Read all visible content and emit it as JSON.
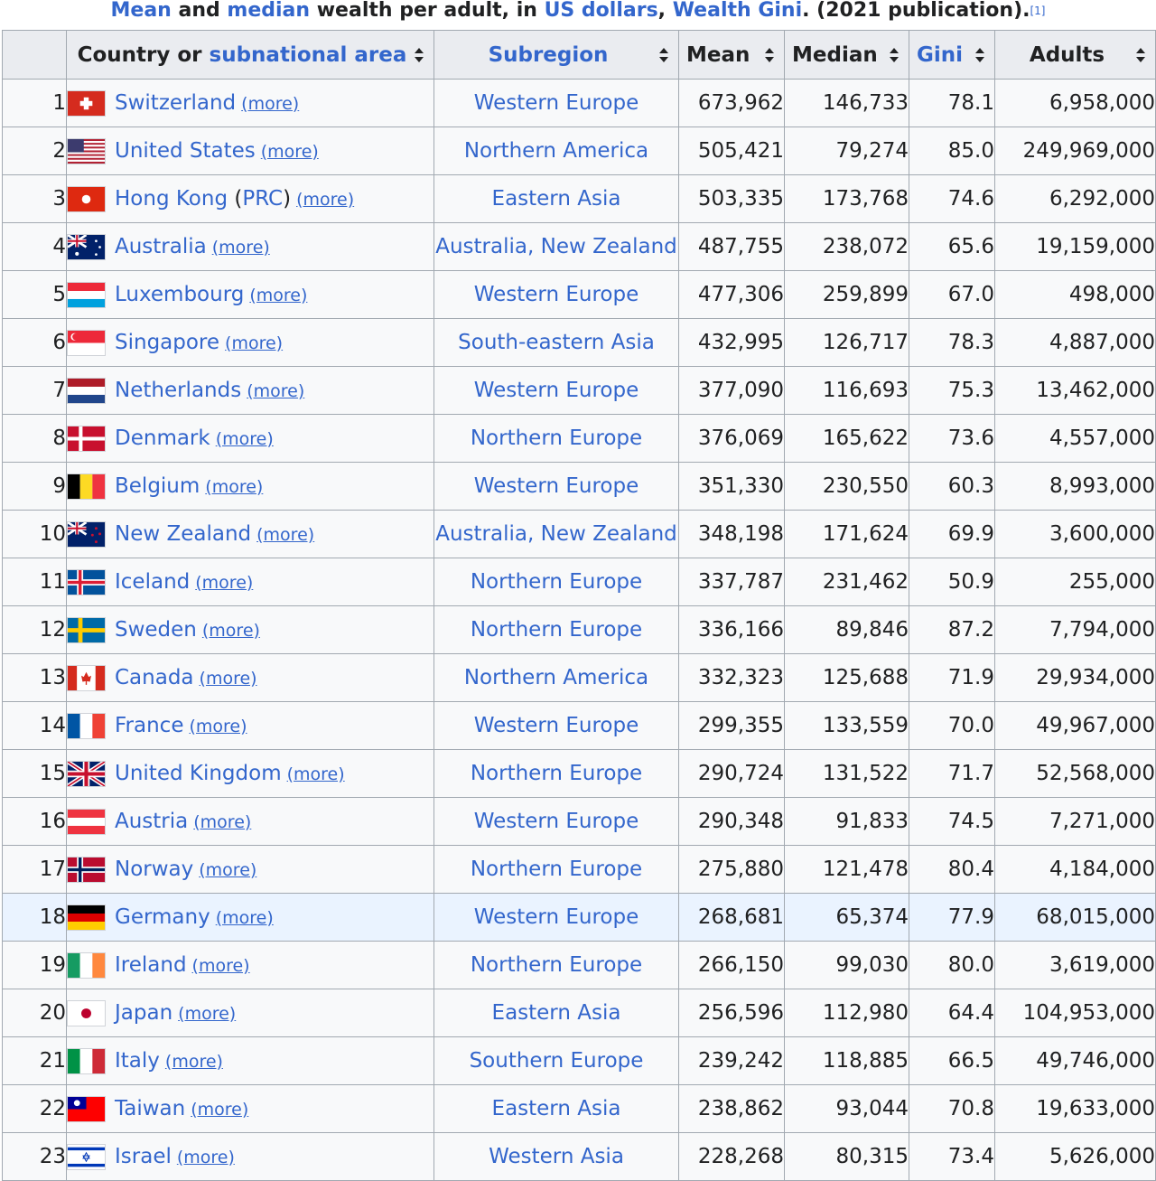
{
  "caption": {
    "mean": "Mean",
    "and": " and ",
    "median": "median",
    "rest": " wealth per adult, in ",
    "usd": "US dollars",
    "comma": ", ",
    "gini": "Wealth Gini",
    "tail": ". (2021 publication).",
    "ref": "[1]"
  },
  "headers": {
    "country_prefix": "Country or ",
    "country_link": "subnational area",
    "subregion": "Subregion",
    "mean": "Mean",
    "median": "Median",
    "gini": "Gini",
    "adults": "Adults"
  },
  "icons": {
    "sort": "sort-icon",
    "flag": "flag-icon"
  },
  "colors": {
    "link": "#3366cc",
    "header_bg": "#eaecf0",
    "cell_bg": "#f8f9fa",
    "highlight": "#eaf3ff",
    "border": "#a2a9b1"
  },
  "more_label": "(more)",
  "rows": [
    {
      "rank": "1",
      "country": "Switzerland",
      "flag": "ch",
      "subregion": "Western Europe",
      "mean": "673,962",
      "median": "146,733",
      "gini": "78.1",
      "adults": "6,958,000"
    },
    {
      "rank": "2",
      "country": "United States",
      "flag": "us",
      "subregion": "Northern America",
      "mean": "505,421",
      "median": "79,274",
      "gini": "85.0",
      "adults": "249,969,000"
    },
    {
      "rank": "3",
      "country": "Hong Kong",
      "suffix": "PRC",
      "flag": "hk",
      "subregion": "Eastern Asia",
      "mean": "503,335",
      "median": "173,768",
      "gini": "74.6",
      "adults": "6,292,000"
    },
    {
      "rank": "4",
      "country": "Australia",
      "flag": "au",
      "subregion": "Australia, New Zealand",
      "mean": "487,755",
      "median": "238,072",
      "gini": "65.6",
      "adults": "19,159,000"
    },
    {
      "rank": "5",
      "country": "Luxembourg",
      "flag": "lu",
      "subregion": "Western Europe",
      "mean": "477,306",
      "median": "259,899",
      "gini": "67.0",
      "adults": "498,000"
    },
    {
      "rank": "6",
      "country": "Singapore",
      "flag": "sg",
      "subregion": "South-eastern Asia",
      "mean": "432,995",
      "median": "126,717",
      "gini": "78.3",
      "adults": "4,887,000"
    },
    {
      "rank": "7",
      "country": "Netherlands",
      "flag": "nl",
      "subregion": "Western Europe",
      "mean": "377,090",
      "median": "116,693",
      "gini": "75.3",
      "adults": "13,462,000"
    },
    {
      "rank": "8",
      "country": "Denmark",
      "flag": "dk",
      "subregion": "Northern Europe",
      "mean": "376,069",
      "median": "165,622",
      "gini": "73.6",
      "adults": "4,557,000"
    },
    {
      "rank": "9",
      "country": "Belgium",
      "flag": "be",
      "subregion": "Western Europe",
      "mean": "351,330",
      "median": "230,550",
      "gini": "60.3",
      "adults": "8,993,000"
    },
    {
      "rank": "10",
      "country": "New Zealand",
      "flag": "nz",
      "subregion": "Australia, New Zealand",
      "mean": "348,198",
      "median": "171,624",
      "gini": "69.9",
      "adults": "3,600,000"
    },
    {
      "rank": "11",
      "country": "Iceland",
      "flag": "is",
      "subregion": "Northern Europe",
      "mean": "337,787",
      "median": "231,462",
      "gini": "50.9",
      "adults": "255,000"
    },
    {
      "rank": "12",
      "country": "Sweden",
      "flag": "se",
      "subregion": "Northern Europe",
      "mean": "336,166",
      "median": "89,846",
      "gini": "87.2",
      "adults": "7,794,000"
    },
    {
      "rank": "13",
      "country": "Canada",
      "flag": "ca",
      "subregion": "Northern America",
      "mean": "332,323",
      "median": "125,688",
      "gini": "71.9",
      "adults": "29,934,000"
    },
    {
      "rank": "14",
      "country": "France",
      "flag": "fr",
      "subregion": "Western Europe",
      "mean": "299,355",
      "median": "133,559",
      "gini": "70.0",
      "adults": "49,967,000"
    },
    {
      "rank": "15",
      "country": "United Kingdom",
      "flag": "gb",
      "subregion": "Northern Europe",
      "mean": "290,724",
      "median": "131,522",
      "gini": "71.7",
      "adults": "52,568,000"
    },
    {
      "rank": "16",
      "country": "Austria",
      "flag": "at",
      "subregion": "Western Europe",
      "mean": "290,348",
      "median": "91,833",
      "gini": "74.5",
      "adults": "7,271,000"
    },
    {
      "rank": "17",
      "country": "Norway",
      "flag": "no",
      "subregion": "Northern Europe",
      "mean": "275,880",
      "median": "121,478",
      "gini": "80.4",
      "adults": "4,184,000"
    },
    {
      "rank": "18",
      "country": "Germany",
      "flag": "de",
      "subregion": "Western Europe",
      "mean": "268,681",
      "median": "65,374",
      "gini": "77.9",
      "adults": "68,015,000",
      "highlight": true
    },
    {
      "rank": "19",
      "country": "Ireland",
      "flag": "ie",
      "subregion": "Northern Europe",
      "mean": "266,150",
      "median": "99,030",
      "gini": "80.0",
      "adults": "3,619,000"
    },
    {
      "rank": "20",
      "country": "Japan",
      "flag": "jp",
      "subregion": "Eastern Asia",
      "mean": "256,596",
      "median": "112,980",
      "gini": "64.4",
      "adults": "104,953,000"
    },
    {
      "rank": "21",
      "country": "Italy",
      "flag": "it",
      "subregion": "Southern Europe",
      "mean": "239,242",
      "median": "118,885",
      "gini": "66.5",
      "adults": "49,746,000"
    },
    {
      "rank": "22",
      "country": "Taiwan",
      "flag": "tw",
      "subregion": "Eastern Asia",
      "mean": "238,862",
      "median": "93,044",
      "gini": "70.8",
      "adults": "19,633,000"
    },
    {
      "rank": "23",
      "country": "Israel",
      "flag": "il",
      "subregion": "Western Asia",
      "mean": "228,268",
      "median": "80,315",
      "gini": "73.4",
      "adults": "5,626,000"
    }
  ]
}
